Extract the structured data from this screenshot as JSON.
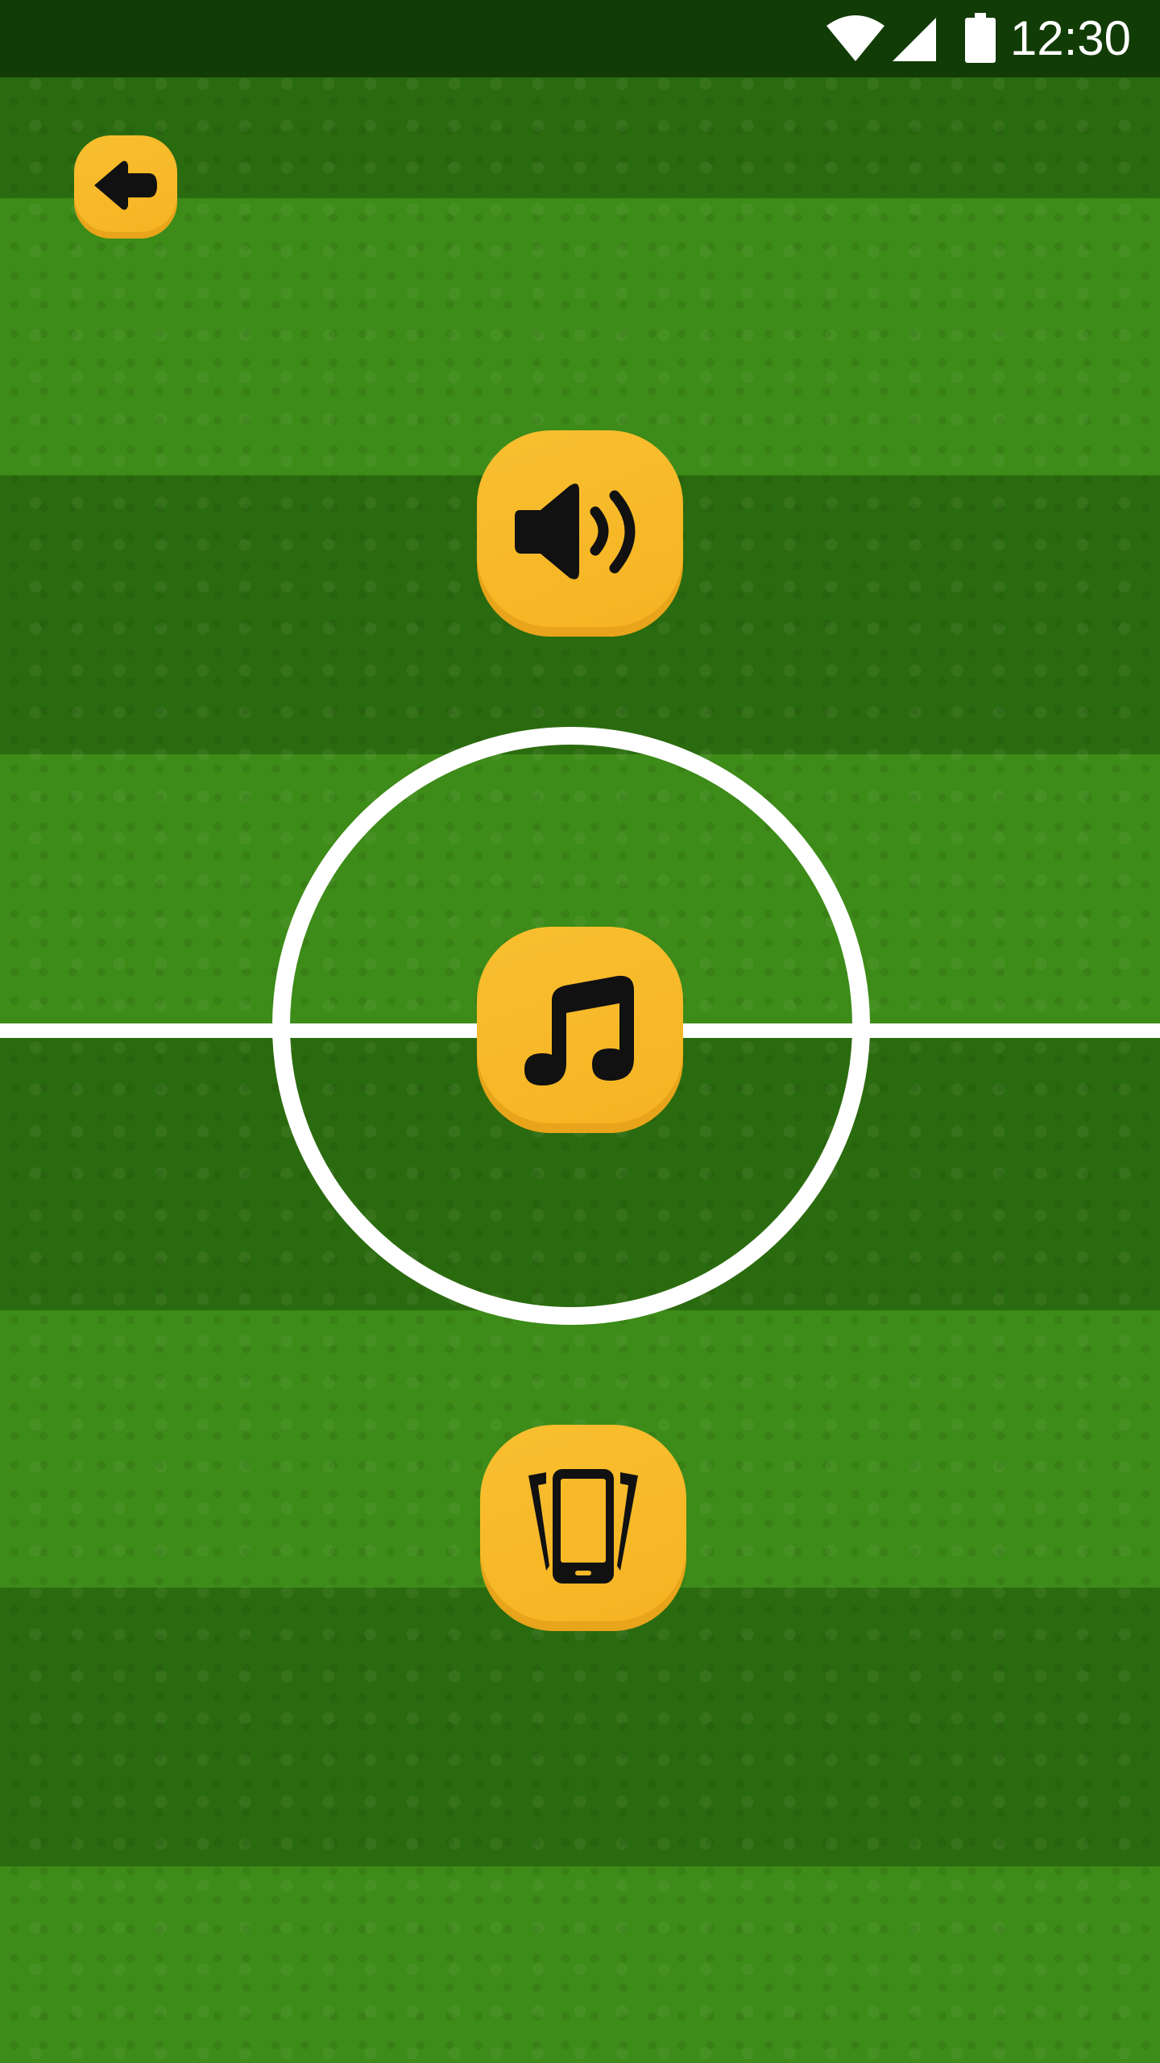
{
  "status_bar": {
    "time": "12:30",
    "icons": [
      "wifi-icon",
      "cellular-signal-icon",
      "battery-icon"
    ]
  },
  "colors": {
    "button_yellow": "#F8BF30",
    "field_green_light": "#3D8B18",
    "field_green_dark": "#2B6B0F",
    "status_bar": "#123C06",
    "line_white": "#FFFFFF",
    "icon_black": "#111111"
  },
  "controls": {
    "back": {
      "icon": "back-arrow-icon"
    },
    "sound": {
      "icon": "speaker-volume-icon"
    },
    "music": {
      "icon": "music-note-icon"
    },
    "vibration": {
      "icon": "vibrate-phone-icon"
    }
  }
}
